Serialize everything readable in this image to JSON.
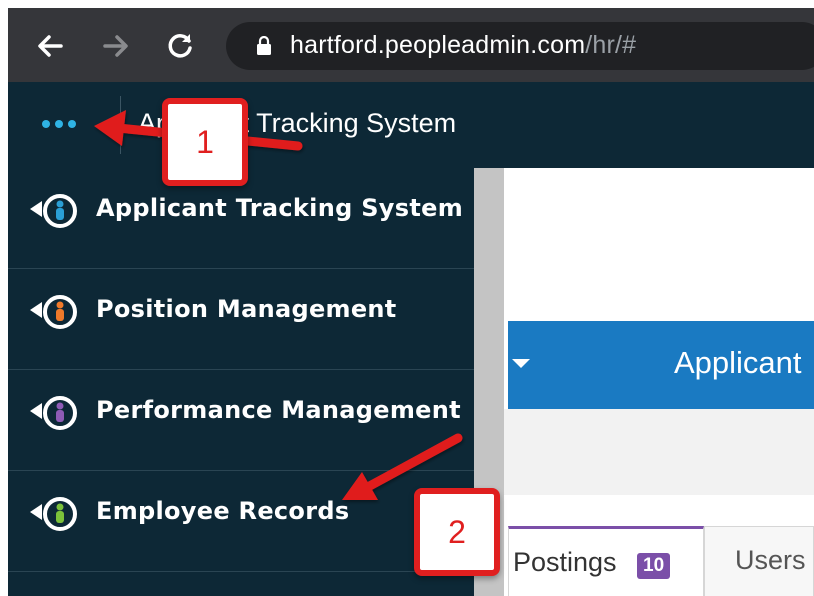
{
  "browser": {
    "url_host": "hartford.peopleadmin.com",
    "url_path": "/hr/#"
  },
  "header": {
    "title": "Applicant Tracking System"
  },
  "sidebar": {
    "items": [
      {
        "label": "Applicant Tracking System",
        "icon": "person-cycle-icon",
        "person_color": "#2a9fd6"
      },
      {
        "label": "Position Management",
        "icon": "person-cycle-icon",
        "person_color": "#f07a2a"
      },
      {
        "label": "Performance Management",
        "icon": "person-cycle-icon",
        "person_color": "#8e5bb5"
      },
      {
        "label": "Employee Records",
        "icon": "person-cycle-icon",
        "person_color": "#7cc23a"
      }
    ]
  },
  "main": {
    "banner_title": "Applicant",
    "tabs": [
      {
        "label": "Postings",
        "badge": "10"
      },
      {
        "label": "Users"
      }
    ]
  },
  "annotations": {
    "callout_1": "1",
    "callout_2": "2"
  },
  "colors": {
    "sidebar_bg": "#0d2836",
    "banner_blue": "#1a7ac2",
    "badge_purple": "#7b4fa8",
    "annotation_red": "#e01f1f"
  }
}
